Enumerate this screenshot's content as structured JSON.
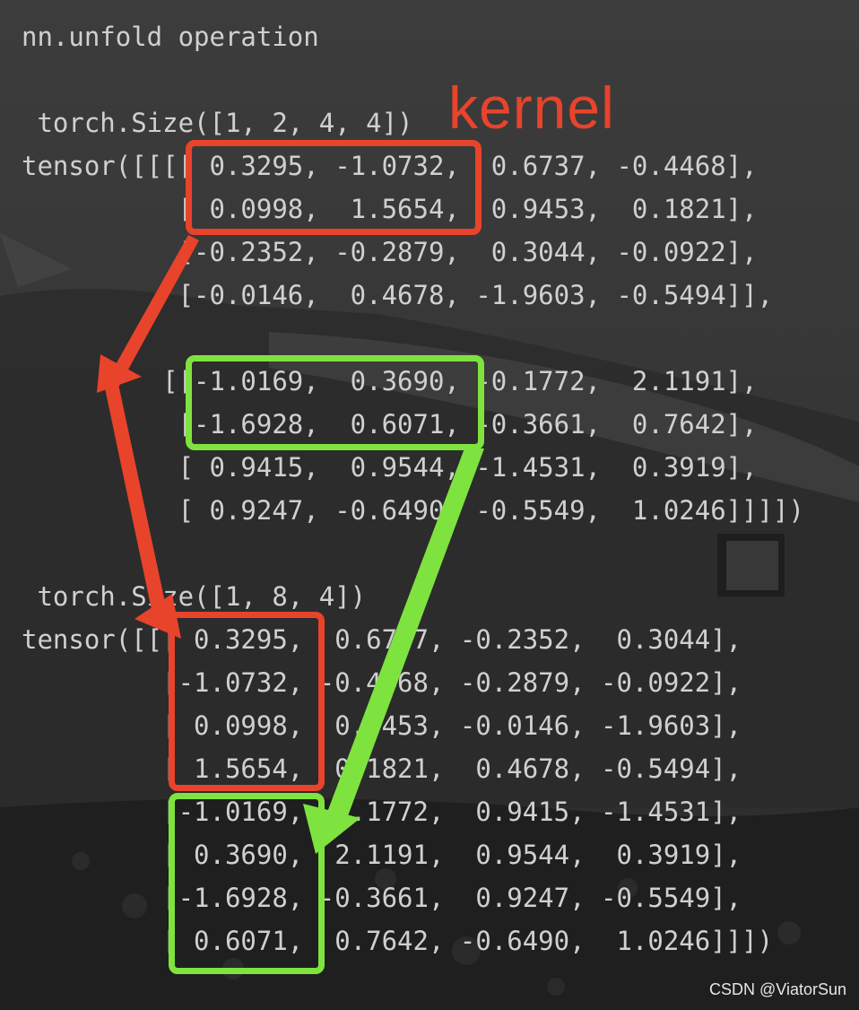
{
  "title": "nn.unfold operation",
  "annotation_label": "kernel",
  "input_block": {
    "size_line": " torch.Size([1, 2, 4, 4])",
    "lines": [
      "tensor([[[[ 0.3295, -1.0732,  0.6737, -0.4468],",
      "          [ 0.0998,  1.5654,  0.9453,  0.1821],",
      "          [-0.2352, -0.2879,  0.3044, -0.0922],",
      "          [-0.0146,  0.4678, -1.9603, -0.5494]],",
      "",
      "         [[-1.0169,  0.3690, -0.1772,  2.1191],",
      "          [-1.6928,  0.6071, -0.3661,  0.7642],",
      "          [ 0.9415,  0.9544, -1.4531,  0.3919],",
      "          [ 0.9247, -0.6490, -0.5549,  1.0246]]]])"
    ]
  },
  "output_block": {
    "size_line": " torch.Size([1, 8, 4])",
    "lines": [
      "tensor([[[ 0.3295,  0.6737, -0.2352,  0.3044],",
      "         [-1.0732, -0.4468, -0.2879, -0.0922],",
      "         [ 0.0998,  0.9453, -0.0146, -1.9603],",
      "         [ 1.5654,  0.1821,  0.4678, -0.5494],",
      "         [-1.0169, -0.1772,  0.9415, -1.4531],",
      "         [ 0.3690,  2.1191,  0.9544,  0.3919],",
      "         [-1.6928, -0.3661,  0.9247, -0.5549],",
      "         [ 0.6071,  0.7642, -0.6490,  1.0246]]])"
    ]
  },
  "colors": {
    "red": "#e8432b",
    "green": "#7fe33f",
    "text": "#d2d2d2",
    "background": "#333333"
  },
  "watermark": "CSDN @ViatorSun"
}
